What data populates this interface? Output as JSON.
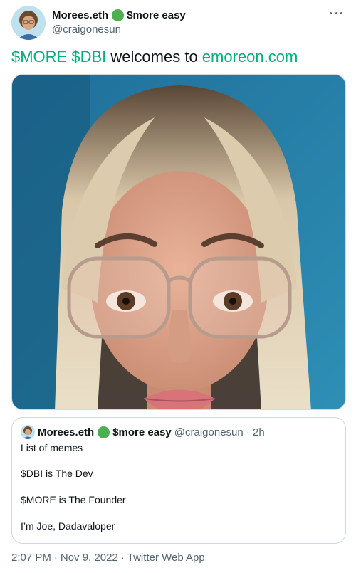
{
  "author": {
    "display_name": "Morees.eth",
    "name_suffix": "$more easy",
    "handle": "@craigonesun"
  },
  "tweet": {
    "text_tag1": "$MORE",
    "text_tag2": "$DBI",
    "text_middle": " welcomes to ",
    "text_link": "emoreon.com"
  },
  "quote": {
    "display_name": "Morees.eth",
    "name_suffix": "$more easy",
    "handle_time": "@craigonesun · 2h",
    "lines": [
      "List of memes",
      "$DBI is The Dev",
      "$MORE is The Founder",
      "I’m Joe, Dadavaloper"
    ]
  },
  "footer": {
    "time": "2:07 PM",
    "date": "Nov 9, 2022",
    "source": "Twitter Web App",
    "separator": "·"
  },
  "colors": {
    "link": "#00b075",
    "badge": "#4caf50",
    "secondary_text": "#536471"
  },
  "icons": {
    "more": "more-horizontal-icon",
    "badge": "green-circle-badge-icon"
  }
}
